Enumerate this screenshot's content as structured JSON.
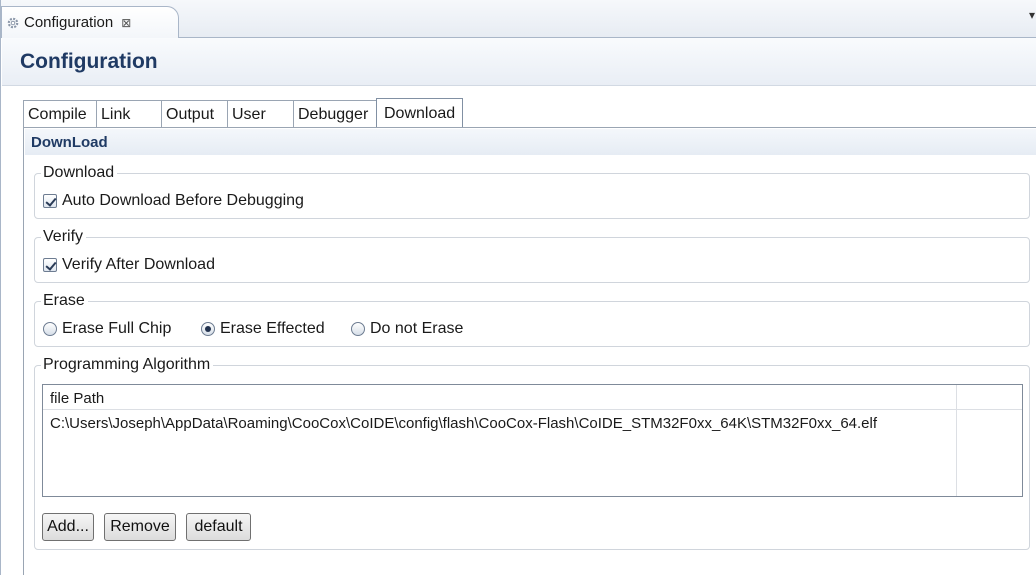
{
  "view_tab": {
    "label": "Configuration",
    "close_glyph": "⊠"
  },
  "form": {
    "title": "Configuration"
  },
  "tabs": [
    {
      "label": "Compile",
      "active": false
    },
    {
      "label": "Link",
      "active": false
    },
    {
      "label": "Output",
      "active": false
    },
    {
      "label": "User",
      "active": false
    },
    {
      "label": "Debugger",
      "active": false
    },
    {
      "label": "Download",
      "active": true
    }
  ],
  "section": {
    "title": "DownLoad"
  },
  "download_group": {
    "legend": "Download",
    "auto_download_label": "Auto Download Before Debugging",
    "auto_download_checked": true
  },
  "verify_group": {
    "legend": "Verify",
    "verify_label": "Verify After Download",
    "verify_checked": true
  },
  "erase_group": {
    "legend": "Erase",
    "options": [
      {
        "label": "Erase Full Chip",
        "selected": false
      },
      {
        "label": "Erase Effected",
        "selected": true
      },
      {
        "label": "Do not Erase",
        "selected": false
      }
    ]
  },
  "algorithm_group": {
    "legend": "Programming Algorithm",
    "columns": [
      "file Path",
      ""
    ],
    "rows": [
      [
        "C:\\Users\\Joseph\\AppData\\Roaming\\CooCox\\CoIDE\\config\\flash\\CooCox-Flash\\CoIDE_STM32F0xx_64K\\STM32F0xx_64.elf"
      ]
    ],
    "buttons": {
      "add": "Add...",
      "remove": "Remove",
      "default": "default"
    }
  },
  "icons": {
    "view_icon": "gear-icon",
    "check_mark": "check-icon"
  },
  "colors": {
    "title": "#1f3a64",
    "border": "#a9b6c8"
  }
}
